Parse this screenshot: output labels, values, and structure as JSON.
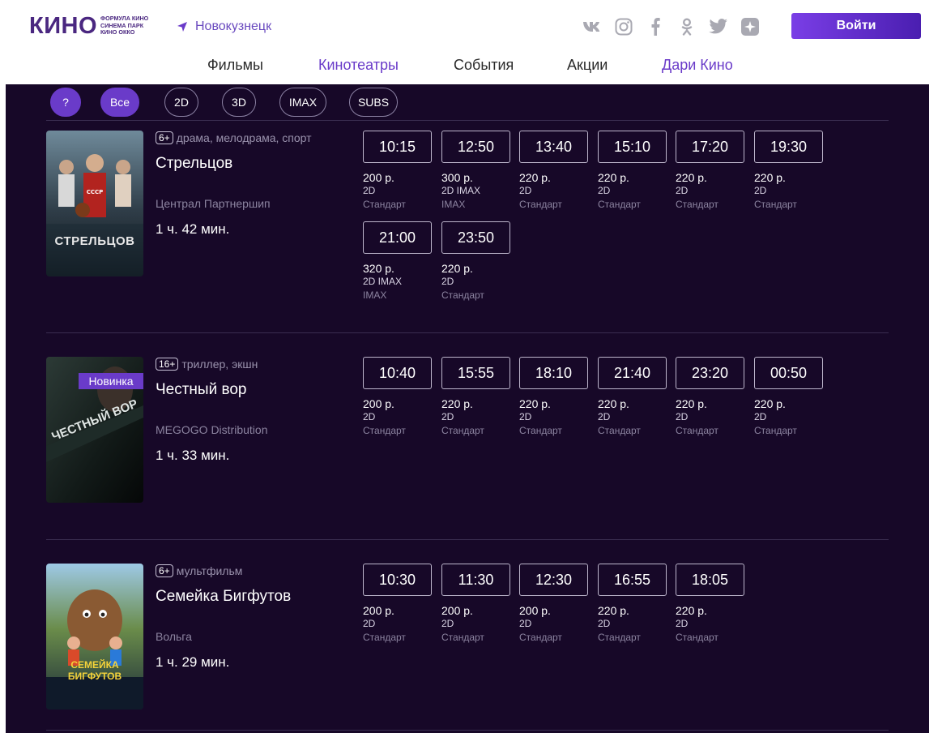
{
  "header": {
    "logo_main": "КИНО",
    "logo_sub": [
      "ФОРМУЛА КИНО",
      "СИНЕМА ПАРК",
      "КИНО ОККО"
    ],
    "city": "Новокузнецк",
    "login_label": "Войти",
    "socials": [
      "vk-icon",
      "instagram-icon",
      "facebook-icon",
      "odnoklassniki-icon",
      "twitter-icon",
      "sparkle-app-icon"
    ]
  },
  "nav": [
    {
      "label": "Фильмы",
      "highlight": false
    },
    {
      "label": "Кинотеатры",
      "highlight": true
    },
    {
      "label": "События",
      "highlight": false
    },
    {
      "label": "Акции",
      "highlight": false
    },
    {
      "label": "Дари Кино",
      "highlight": true
    }
  ],
  "filters": [
    {
      "label": "?",
      "active": true
    },
    {
      "label": "Все",
      "active": true
    },
    {
      "label": "2D",
      "active": false
    },
    {
      "label": "3D",
      "active": false
    },
    {
      "label": "IMAX",
      "active": false
    },
    {
      "label": "SUBS",
      "active": false
    }
  ],
  "movies": [
    {
      "age": "6+",
      "genres": "драма, мелодрама, спорт",
      "title": "Стрельцов",
      "distributor": "Централ Партнершип",
      "duration": "1 ч. 42 мин.",
      "badge": "",
      "poster_title": "СТРЕЛЬЦОВ",
      "sessions": [
        {
          "time": "10:15",
          "price": "200 р.",
          "format": "2D",
          "hall": "Стандарт"
        },
        {
          "time": "12:50",
          "price": "300 р.",
          "format": "2D IMAX",
          "hall": "IMAX"
        },
        {
          "time": "13:40",
          "price": "220 р.",
          "format": "2D",
          "hall": "Стандарт"
        },
        {
          "time": "15:10",
          "price": "220 р.",
          "format": "2D",
          "hall": "Стандарт"
        },
        {
          "time": "17:20",
          "price": "220 р.",
          "format": "2D",
          "hall": "Стандарт"
        },
        {
          "time": "19:30",
          "price": "220 р.",
          "format": "2D",
          "hall": "Стандарт"
        },
        {
          "time": "21:00",
          "price": "320 р.",
          "format": "2D IMAX",
          "hall": "IMAX"
        },
        {
          "time": "23:50",
          "price": "220 р.",
          "format": "2D",
          "hall": "Стандарт"
        }
      ]
    },
    {
      "age": "16+",
      "genres": "триллер, экшн",
      "title": "Честный вор",
      "distributor": "MEGOGO Distribution",
      "duration": "1 ч. 33 мин.",
      "badge": "Новинка",
      "poster_title": "ЧЕСТНЫЙ ВОР",
      "sessions": [
        {
          "time": "10:40",
          "price": "200 р.",
          "format": "2D",
          "hall": "Стандарт"
        },
        {
          "time": "15:55",
          "price": "220 р.",
          "format": "2D",
          "hall": "Стандарт"
        },
        {
          "time": "18:10",
          "price": "220 р.",
          "format": "2D",
          "hall": "Стандарт"
        },
        {
          "time": "21:40",
          "price": "220 р.",
          "format": "2D",
          "hall": "Стандарт"
        },
        {
          "time": "23:20",
          "price": "220 р.",
          "format": "2D",
          "hall": "Стандарт"
        },
        {
          "time": "00:50",
          "price": "220 р.",
          "format": "2D",
          "hall": "Стандарт"
        }
      ]
    },
    {
      "age": "6+",
      "genres": "мультфильм",
      "title": "Семейка Бигфутов",
      "distributor": "Вольга",
      "duration": "1 ч. 29 мин.",
      "badge": "",
      "poster_title": "СЕМЕЙКА БИГФУТОВ",
      "sessions": [
        {
          "time": "10:30",
          "price": "200 р.",
          "format": "2D",
          "hall": "Стандарт"
        },
        {
          "time": "11:30",
          "price": "200 р.",
          "format": "2D",
          "hall": "Стандарт"
        },
        {
          "time": "12:30",
          "price": "200 р.",
          "format": "2D",
          "hall": "Стандарт"
        },
        {
          "time": "16:55",
          "price": "220 р.",
          "format": "2D",
          "hall": "Стандарт"
        },
        {
          "time": "18:05",
          "price": "220 р.",
          "format": "2D",
          "hall": "Стандарт"
        }
      ]
    }
  ]
}
